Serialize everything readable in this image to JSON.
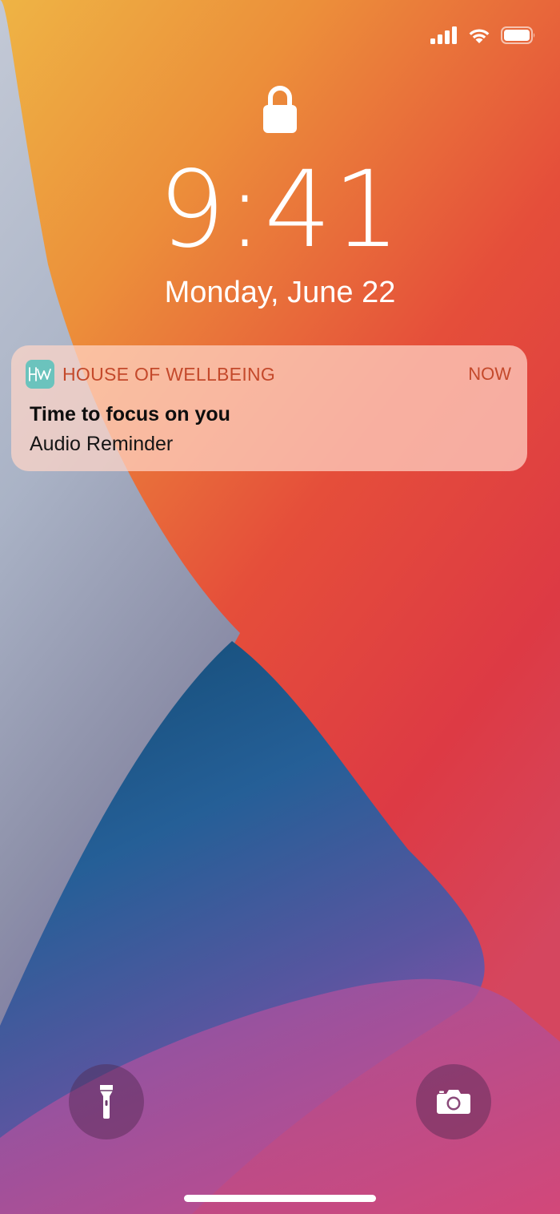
{
  "status_bar": {
    "icons": [
      "cellular-signal-icon",
      "wifi-icon",
      "battery-icon"
    ]
  },
  "lock_screen": {
    "lock_icon": "lock-icon",
    "time": "9:41",
    "date": "Monday, June 22"
  },
  "notification": {
    "app_icon": "house-of-wellbeing-app-icon",
    "app_name": "HOUSE OF WELLBEING",
    "time": "NOW",
    "title": "Time to focus on you",
    "body": "Audio Reminder"
  },
  "quick_actions": {
    "left": "flashlight-icon",
    "right": "camera-icon"
  },
  "colors": {
    "accent_text": "#c4492b",
    "app_icon_bg": "#6bc3bd"
  }
}
